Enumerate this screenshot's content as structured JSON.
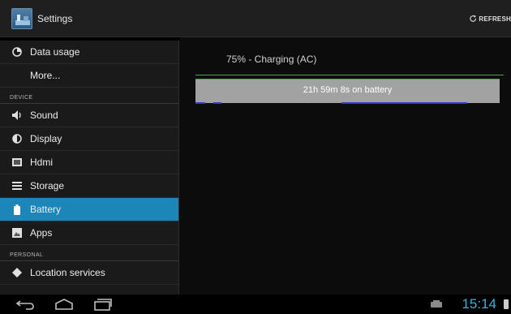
{
  "action_bar": {
    "title": "Settings",
    "refresh_label": "REFRESH"
  },
  "sidebar": {
    "items": [
      {
        "label": "Data usage",
        "icon": "data-usage-icon"
      },
      {
        "label": "More...",
        "icon": ""
      },
      {
        "section": "DEVICE"
      },
      {
        "label": "Sound",
        "icon": "speaker-icon"
      },
      {
        "label": "Display",
        "icon": "brightness-icon"
      },
      {
        "label": "Hdmi",
        "icon": "hdmi-icon"
      },
      {
        "label": "Storage",
        "icon": "storage-icon"
      },
      {
        "label": "Battery",
        "icon": "battery-icon",
        "selected": true
      },
      {
        "label": "Apps",
        "icon": "apps-icon"
      },
      {
        "section": "PERSONAL"
      },
      {
        "label": "Location services",
        "icon": "location-icon"
      }
    ]
  },
  "battery": {
    "status": "75% - Charging (AC)",
    "graph_label": "21h 59m 8s on battery"
  },
  "status_bar": {
    "time": "15:14"
  },
  "colors": {
    "accent": "#1d86b8",
    "clock": "#33b5e5",
    "graph": "#a2a2a2",
    "graph_line": "#3fa93b",
    "awake_segments": "#2c3fd0"
  }
}
